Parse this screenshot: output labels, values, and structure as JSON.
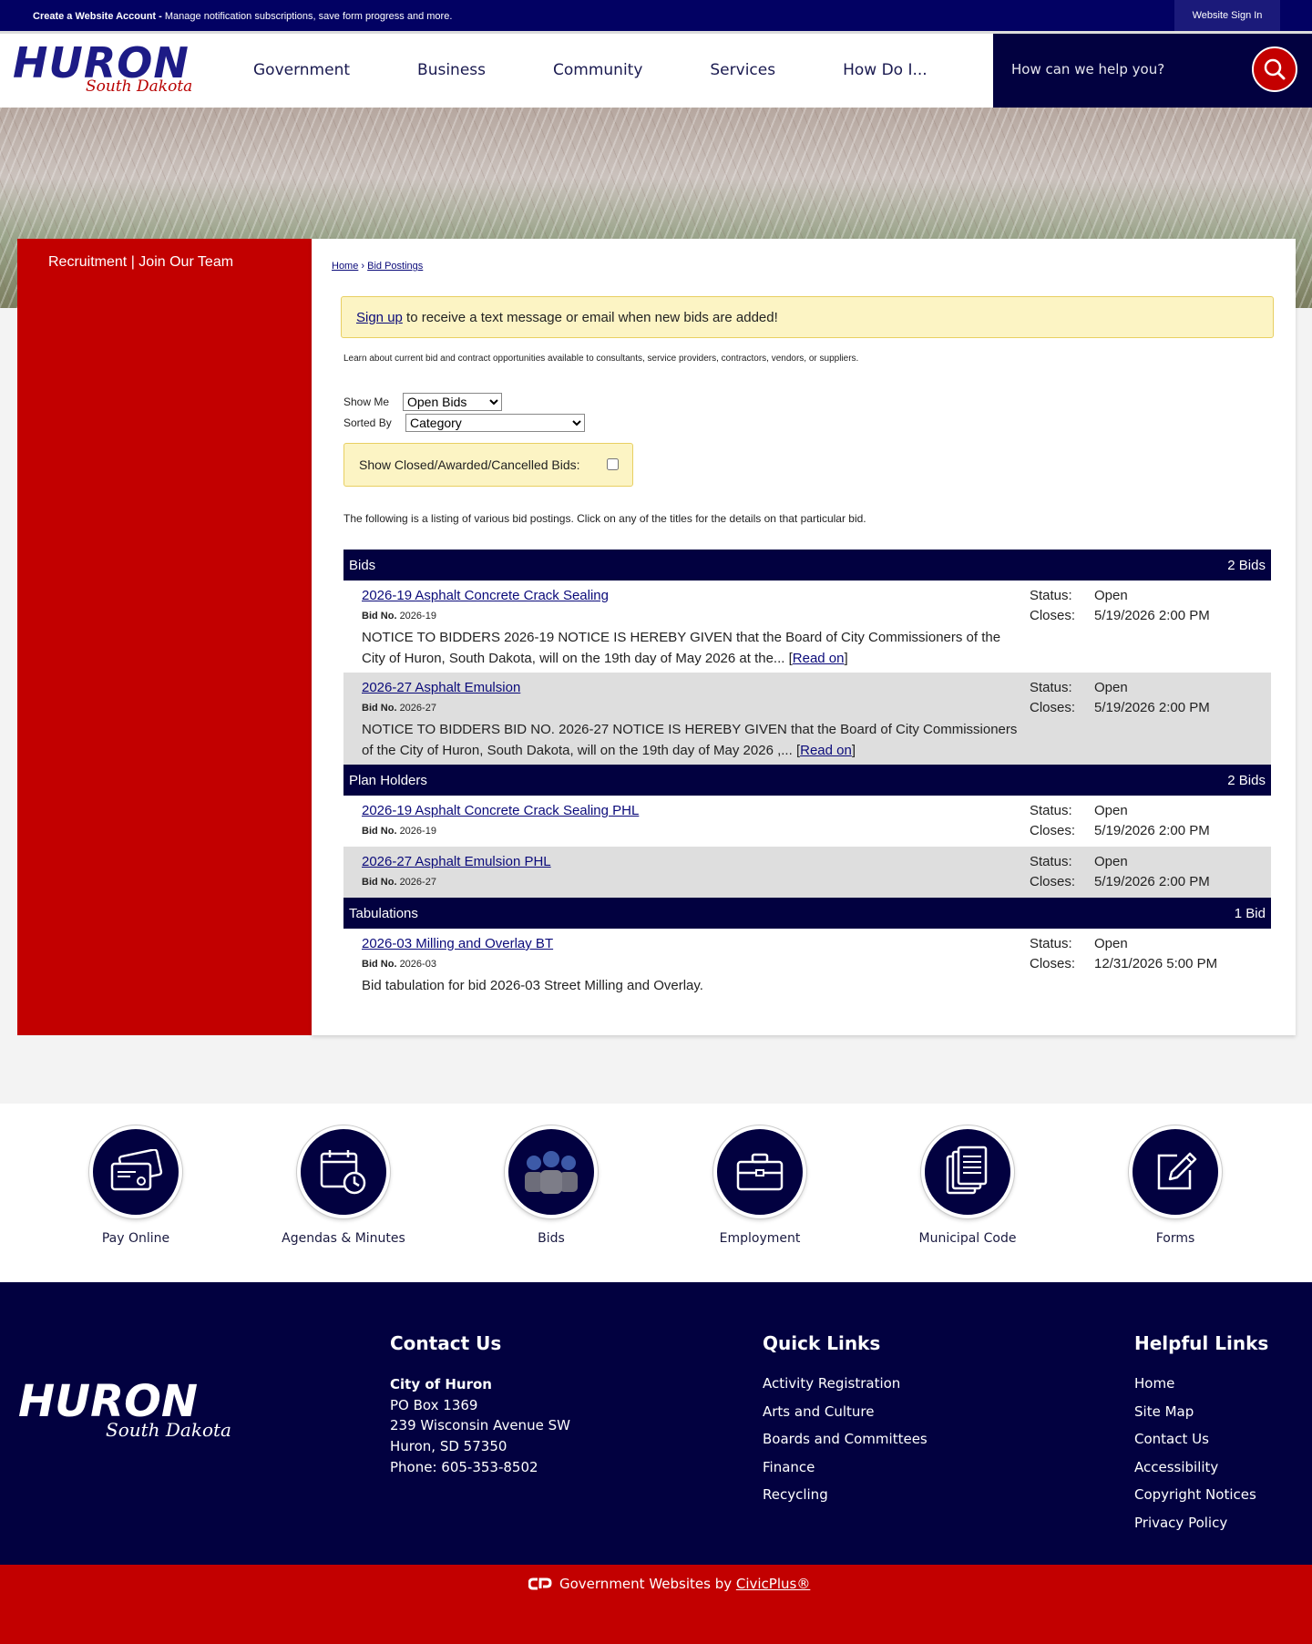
{
  "topbar": {
    "create_account": "Create a Website Account -",
    "create_account_desc": "Manage notification subscriptions, save form progress and more.",
    "sign_in": "Website Sign In"
  },
  "logo": {
    "name": "HURON",
    "state": "South Dakota"
  },
  "nav": [
    "Government",
    "Business",
    "Community",
    "Services",
    "How Do I..."
  ],
  "search": {
    "placeholder": "How can we help you?"
  },
  "sidebar": {
    "link": "Recruitment | Join Our Team"
  },
  "breadcrumb": {
    "home": "Home",
    "separator": "›",
    "current": "Bid Postings"
  },
  "alert": {
    "link": "Sign up",
    "text": " to receive a text message or email when new bids are added!"
  },
  "intro": "Learn about current bid and contract opportunities available to consultants, service providers, contractors, vendors, or suppliers.",
  "filters": {
    "show_me_label": "Show Me",
    "show_me_value": "Open Bids",
    "sorted_by_label": "Sorted By",
    "sorted_by_value": "Category",
    "closed_label": "Show Closed/Awarded/Cancelled Bids:"
  },
  "listing_text": "The following is a listing of various bid postings. Click on any of the titles for the details on that particular bid.",
  "labels": {
    "bid_no": "Bid No.",
    "status": "Status:",
    "closes": "Closes:",
    "read_on": "Read on"
  },
  "categories": [
    {
      "name": "Bids",
      "count": "2 Bids",
      "bids": [
        {
          "title": "2026-19 Asphalt Concrete Crack Sealing",
          "bid_no": "2026-19",
          "status": "Open",
          "closes": "5/19/2026 2:00 PM",
          "desc": "NOTICE TO BIDDERS 2026-19 NOTICE IS HEREBY GIVEN that the Board of City Commissioners of the City of Huron, South Dakota, will on the 19th day of May 2026 at the... "
        },
        {
          "title": "2026-27 Asphalt Emulsion",
          "bid_no": "2026-27",
          "status": "Open",
          "closes": "5/19/2026 2:00 PM",
          "desc": "NOTICE TO BIDDERS BID NO. 2026-27 NOTICE IS HEREBY GIVEN that the Board of City Commissioners of the City of Huron, South Dakota, will on the 19th day of May 2026 ,... "
        }
      ]
    },
    {
      "name": "Plan Holders",
      "count": "2 Bids",
      "bids": [
        {
          "title": "2026-19 Asphalt Concrete Crack Sealing PHL",
          "bid_no": "2026-19",
          "status": "Open",
          "closes": "5/19/2026 2:00 PM"
        },
        {
          "title": "2026-27 Asphalt Emulsion PHL",
          "bid_no": "2026-27",
          "status": "Open",
          "closes": "5/19/2026 2:00 PM"
        }
      ]
    },
    {
      "name": "Tabulations",
      "count": "1 Bid",
      "bids": [
        {
          "title": "2026-03 Milling and Overlay BT",
          "bid_no": "2026-03",
          "status": "Open",
          "closes": "12/31/2026 5:00 PM",
          "desc": "Bid tabulation for bid 2026-03 Street Milling and Overlay."
        }
      ]
    }
  ],
  "quick_links": [
    {
      "label": "Pay Online",
      "icon": "credit-card-icon"
    },
    {
      "label": "Agendas & Minutes",
      "icon": "calendar-clock-icon"
    },
    {
      "label": "Bids",
      "icon": "workers-icon"
    },
    {
      "label": "Employment",
      "icon": "briefcase-icon"
    },
    {
      "label": "Municipal Code",
      "icon": "documents-icon"
    },
    {
      "label": "Forms",
      "icon": "edit-form-icon"
    }
  ],
  "footer": {
    "contact": {
      "heading": "Contact Us",
      "name": "City of Huron",
      "lines": [
        "PO Box 1369",
        "239 Wisconsin Avenue SW",
        "Huron, SD 57350",
        "Phone: 605-353-8502"
      ]
    },
    "quick": {
      "heading": "Quick Links",
      "items": [
        "Activity Registration",
        "Arts and Culture",
        "Boards and Committees",
        "Finance",
        "Recycling"
      ]
    },
    "helpful": {
      "heading": "Helpful Links",
      "items": [
        "Home",
        "Site Map",
        "Contact Us",
        "Accessibility",
        "Copyright Notices",
        "Privacy Policy"
      ]
    },
    "credit_text": "Government Websites by ",
    "credit_link": "CivicPlus®"
  },
  "colors": {
    "navy": "#020140",
    "red": "#c20000",
    "alert_bg": "#fcf4c4"
  }
}
